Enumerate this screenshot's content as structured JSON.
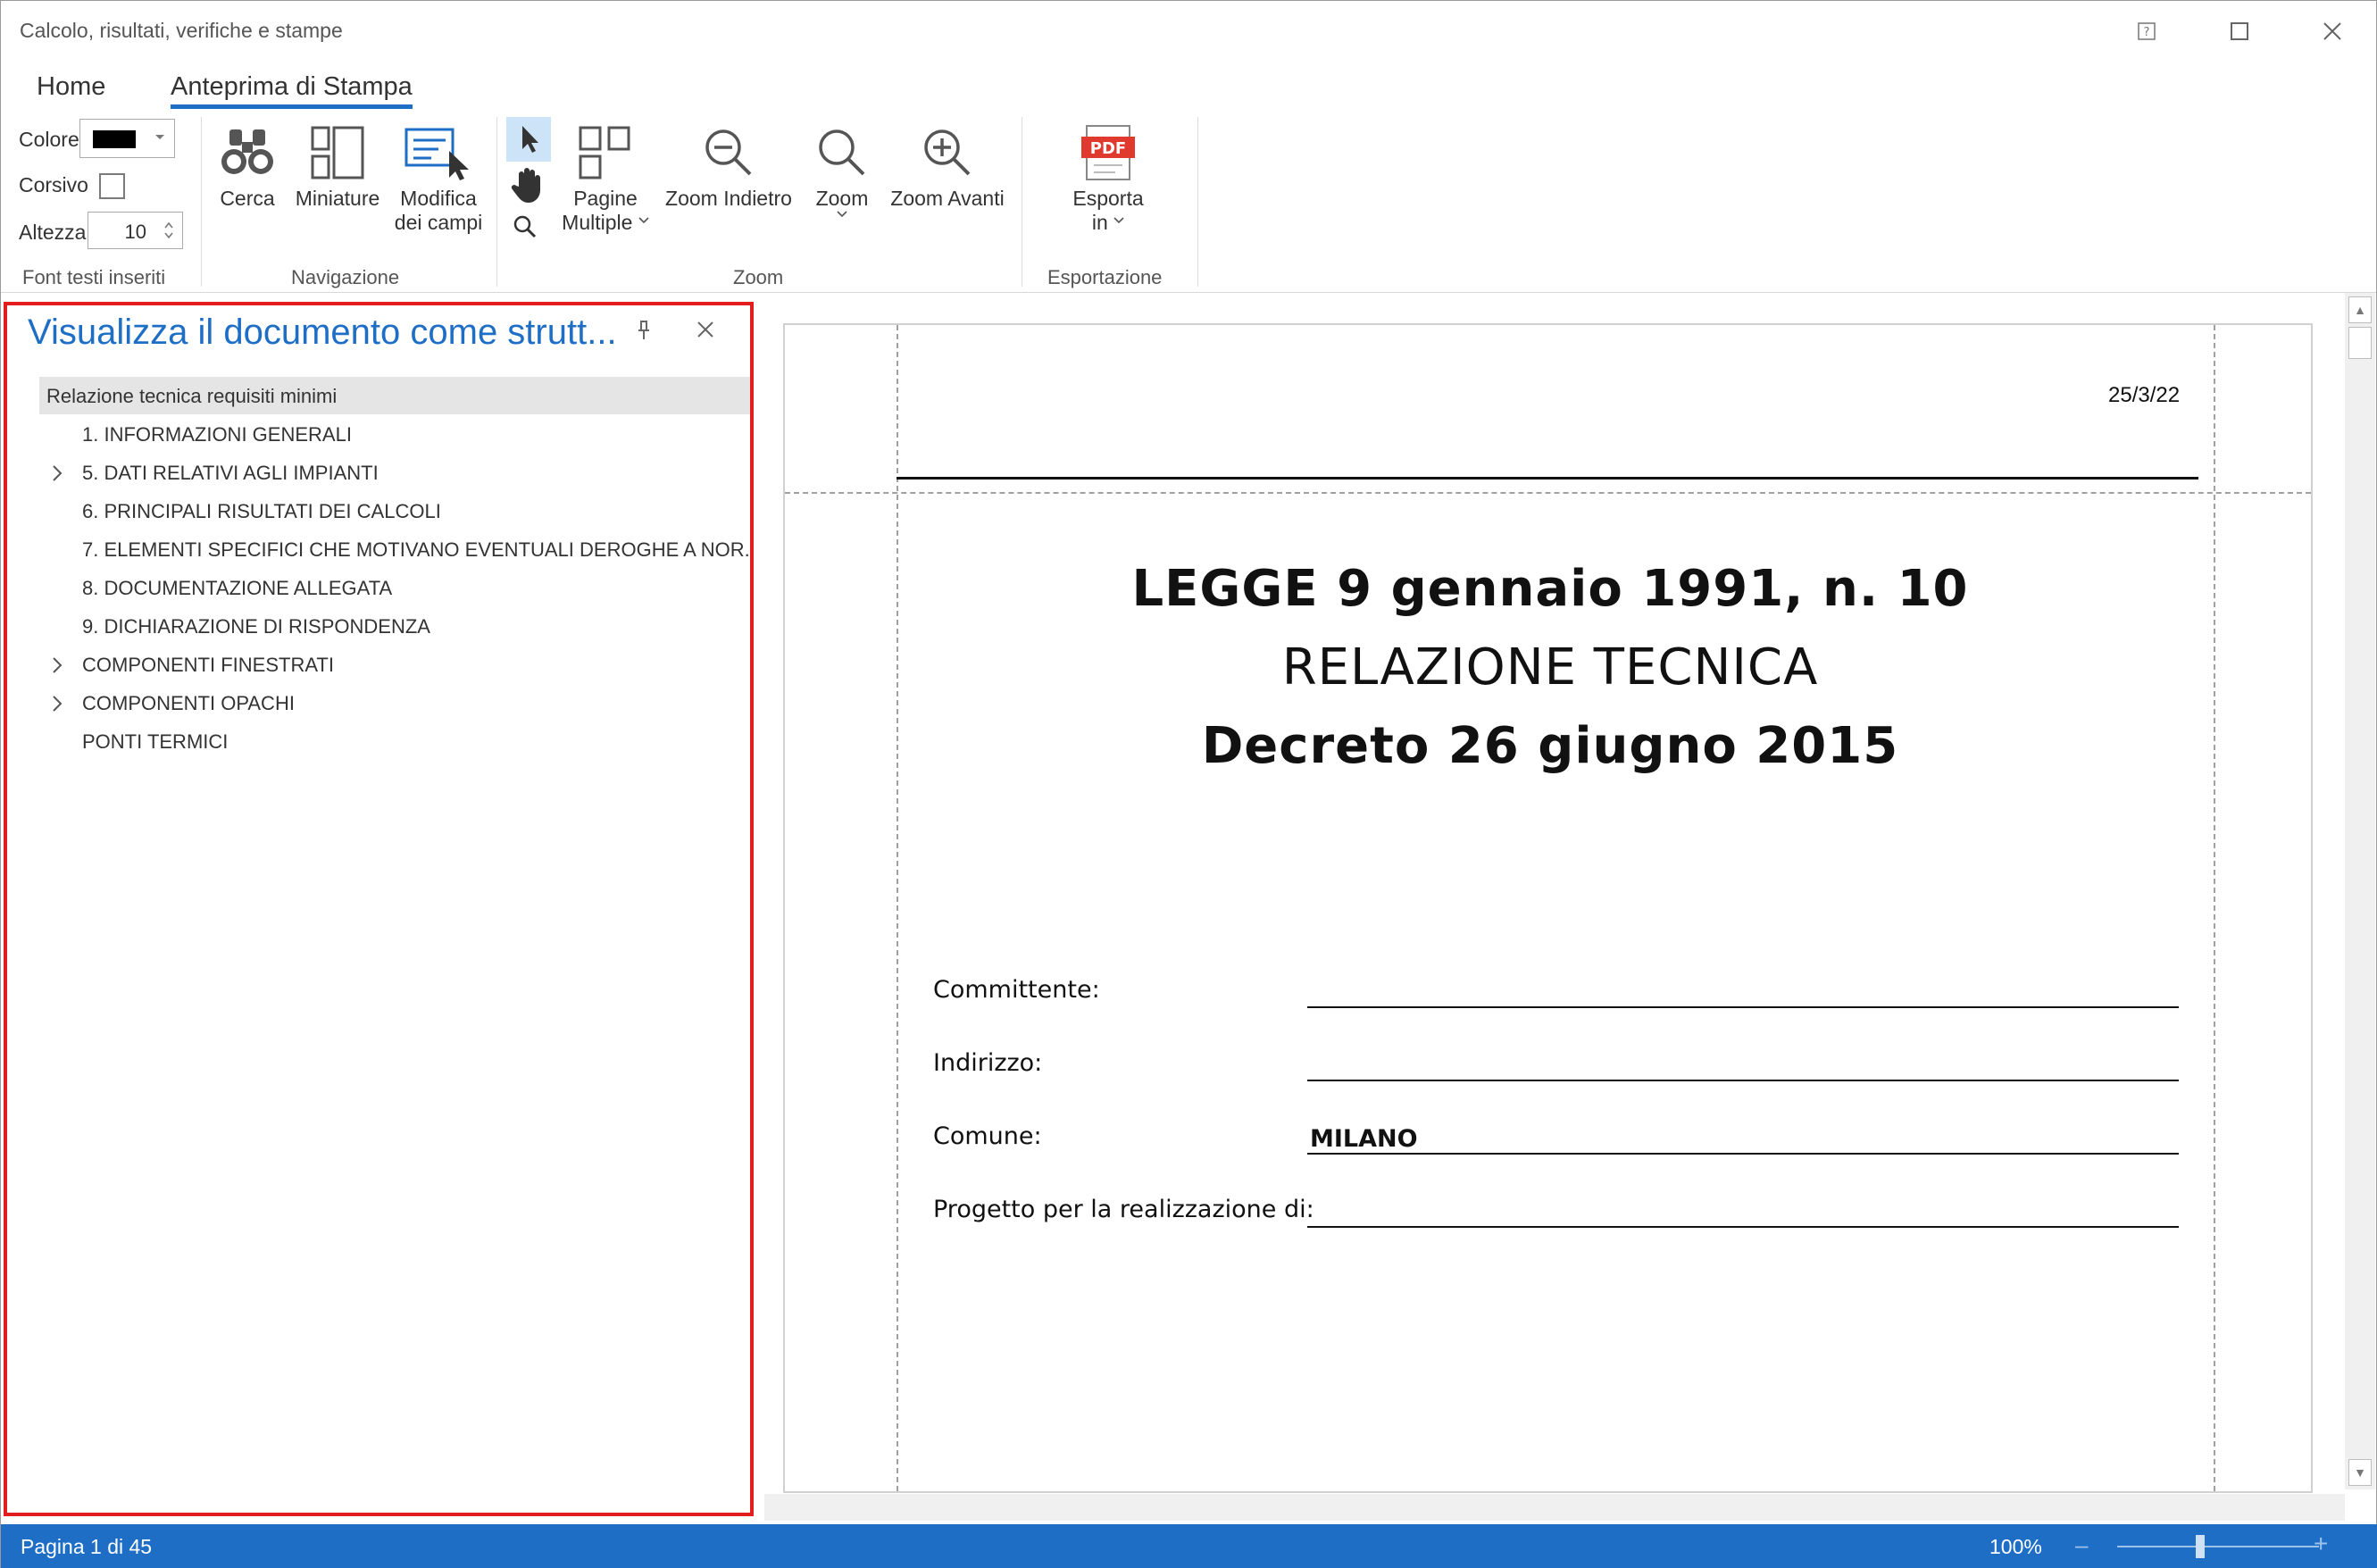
{
  "window": {
    "title": "Calcolo, risultati, verifiche e stampe"
  },
  "tabs": [
    {
      "label": "Home"
    },
    {
      "label": "Anteprima di Stampa"
    }
  ],
  "ribbon": {
    "font_group": {
      "color_label": "Colore",
      "color_value": "#000000",
      "italic_label": "Corsivo",
      "italic_checked": false,
      "height_label": "Altezza",
      "height_value": "10",
      "group_label": "Font testi inseriti"
    },
    "navigation_group": {
      "search_label": "Cerca",
      "thumbnails_label": "Miniature",
      "edit_fields_label_1": "Modifica",
      "edit_fields_label_2": "dei campi",
      "group_label": "Navigazione"
    },
    "zoom_group": {
      "multi_pages_label_1": "Pagine",
      "multi_pages_label_2": "Multiple",
      "zoom_out_label": "Zoom Indietro",
      "zoom_label": "Zoom",
      "zoom_in_label": "Zoom Avanti",
      "group_label": "Zoom"
    },
    "export_group": {
      "export_label_1": "Esporta",
      "export_label_2": "in",
      "pdf_badge": "PDF",
      "group_label": "Esportazione"
    }
  },
  "pane": {
    "title": "Visualizza il documento come strutt...",
    "tree": [
      {
        "label": "Relazione tecnica requisiti minimi",
        "level": 0,
        "expander": "expanded",
        "selected": true
      },
      {
        "label": "1. INFORMAZIONI GENERALI",
        "level": 1,
        "expander": "none"
      },
      {
        "label": "5. DATI RELATIVI AGLI IMPIANTI",
        "level": 1,
        "expander": "collapsed"
      },
      {
        "label": "6. PRINCIPALI RISULTATI DEI CALCOLI",
        "level": 1,
        "expander": "none"
      },
      {
        "label": "7. ELEMENTI SPECIFICI CHE MOTIVANO EVENTUALI DEROGHE A NOR...",
        "level": 1,
        "expander": "none"
      },
      {
        "label": "8. DOCUMENTAZIONE ALLEGATA",
        "level": 1,
        "expander": "none"
      },
      {
        "label": "9. DICHIARAZIONE DI RISPONDENZA",
        "level": 1,
        "expander": "none"
      },
      {
        "label": "COMPONENTI FINESTRATI",
        "level": 1,
        "expander": "collapsed"
      },
      {
        "label": "COMPONENTI OPACHI",
        "level": 1,
        "expander": "collapsed"
      },
      {
        "label": "PONTI TERMICI",
        "level": 1,
        "expander": "none"
      }
    ]
  },
  "document": {
    "date": "25/3/22",
    "heading_1": "LEGGE 9 gennaio 1991, n. 10",
    "heading_2": "RELAZIONE TECNICA",
    "heading_3": "Decreto 26 giugno 2015",
    "fields": [
      {
        "label": "Committente:",
        "value": ""
      },
      {
        "label": "Indirizzo:",
        "value": ""
      },
      {
        "label": "Comune:",
        "value": "MILANO"
      },
      {
        "label": "Progetto per la realizzazione di:",
        "value": ""
      }
    ]
  },
  "status": {
    "page_info": "Pagina 1 di 45",
    "zoom_level": "100%"
  },
  "colors": {
    "accent": "#1e6ec6",
    "highlight_border": "#e31d1d",
    "pdf_red": "#e03a2f"
  }
}
